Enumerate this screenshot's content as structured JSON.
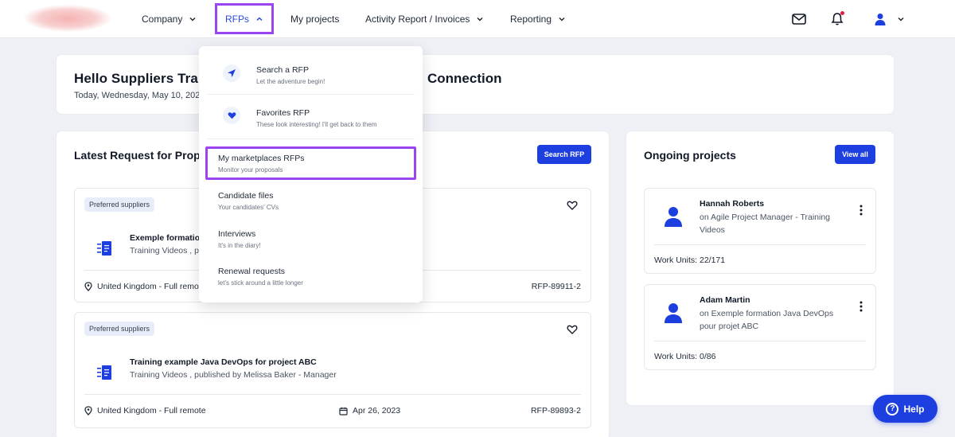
{
  "nav": {
    "items": [
      {
        "label": "Company"
      },
      {
        "label": "RFPs"
      },
      {
        "label": "My projects"
      },
      {
        "label": "Activity Report / Invoices"
      },
      {
        "label": "Reporting"
      }
    ],
    "icons": [
      "mail-icon",
      "bell-icon",
      "user-icon",
      "chevron-down-icon"
    ]
  },
  "hello": {
    "title": "Hello Suppliers Tra",
    "title_tail": "Connection",
    "date": "Today, Wednesday, May 10, 2023"
  },
  "latest": {
    "title": "Latest Request for Prop",
    "search_button": "Search RFP",
    "items": [
      {
        "badge": "Preferred suppliers",
        "name": "Exemple formation",
        "sub": "Training Videos , p",
        "location": "United Kingdom - Full remo",
        "code": "RFP-89911-2"
      },
      {
        "badge": "Preferred suppliers",
        "name": "Training example Java DevOps for project ABC",
        "sub": "Training Videos , published by Melissa Baker - Manager",
        "location": "United Kingdom - Full remote",
        "date": "Apr 26, 2023",
        "code": "RFP-89893-2"
      }
    ]
  },
  "ongoing": {
    "title": "Ongoing projects",
    "view_all": "View all",
    "projects": [
      {
        "name": "Hannah Roberts",
        "desc": "on Agile Project Manager - Training Videos",
        "work_units": "Work Units: 22/171"
      },
      {
        "name": "Adam Martin",
        "desc": "on Exemple formation Java DevOps pour projet ABC",
        "work_units": "Work Units: 0/86"
      }
    ]
  },
  "dropdown": {
    "items": [
      {
        "label": "Search a RFP",
        "sub": "Let the adventure begin!",
        "icon": "send-icon"
      },
      {
        "label": "Favorites RFP",
        "sub": "These look interesting! I'll get back to them",
        "icon": "heart-icon"
      },
      {
        "label": "My marketplaces RFPs",
        "sub": "Monitor your proposals"
      },
      {
        "label": "Candidate files",
        "sub": "Your candidates' CVs"
      },
      {
        "label": "Interviews",
        "sub": "It's in the diary!"
      },
      {
        "label": "Renewal requests",
        "sub": "let's stick around a little longer"
      }
    ]
  },
  "help": {
    "label": "Help"
  },
  "colors": {
    "accent": "#1d3fe0",
    "highlight": "#9b44f0",
    "background": "#eef0f5"
  }
}
